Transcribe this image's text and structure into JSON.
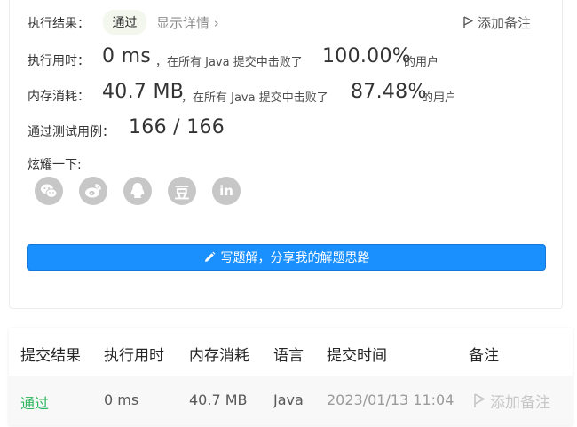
{
  "result": {
    "label": "执行结果：",
    "status": "通过",
    "detail_link": "显示详情",
    "add_note": "添加备注"
  },
  "runtime": {
    "label": "执行用时：",
    "value": "0 ms",
    "mid_text": "，在所有 Java 提交中击败了",
    "percent": "100.00%",
    "suffix": "的用户"
  },
  "memory": {
    "label": "内存消耗：",
    "value": "40.7 MB",
    "mid_text": "，在所有 Java 提交中击败了",
    "percent": "87.48%",
    "suffix": "的用户"
  },
  "tests": {
    "label": "通过测试用例：",
    "value": "166 / 166"
  },
  "share": {
    "label": "炫耀一下:",
    "icons": [
      "wechat-icon",
      "weibo-icon",
      "qq-icon",
      "douban-icon",
      "linkedin-icon"
    ],
    "douban_glyph": "豆",
    "linkedin_glyph": "in"
  },
  "write_solution": {
    "label": "写题解，分享我的解题思路"
  },
  "submissions_table": {
    "headers": [
      "提交结果",
      "执行用时",
      "内存消耗",
      "语言",
      "提交时间",
      "备注"
    ],
    "rows": [
      {
        "result": "通过",
        "runtime": "0 ms",
        "memory": "40.7 MB",
        "language": "Java",
        "time": "2023/01/13 11:04",
        "note": "添加备注"
      }
    ]
  },
  "colors": {
    "accent": "#1a90ff",
    "pass": "#2db55d",
    "badge_bg": "#f3f7ee",
    "share_icon_bg": "#c7c7c7"
  }
}
